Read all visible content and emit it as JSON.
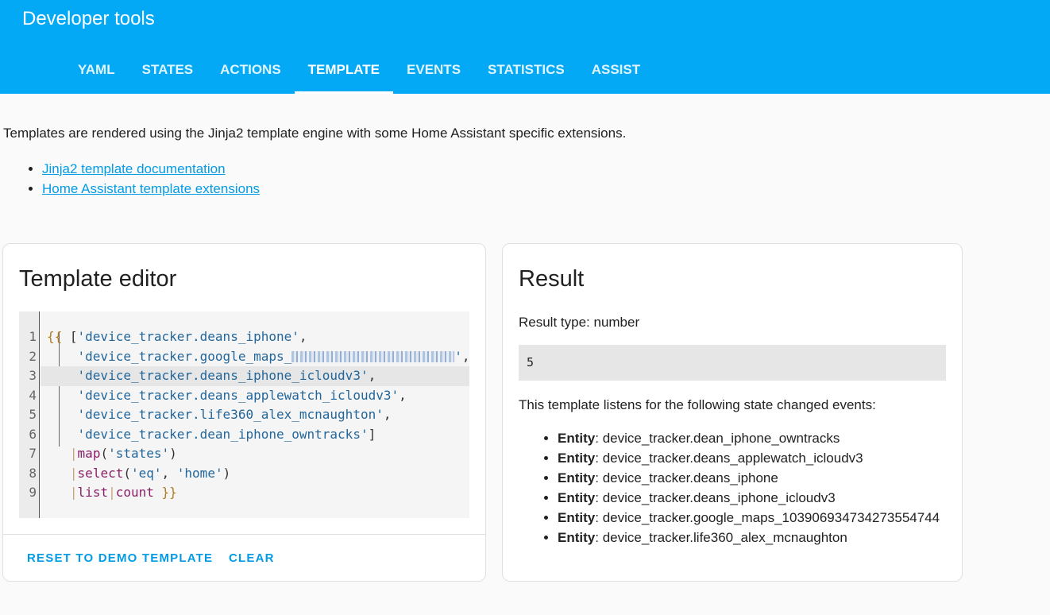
{
  "header": {
    "title": "Developer tools",
    "tabs": [
      {
        "label": "YAML"
      },
      {
        "label": "STATES"
      },
      {
        "label": "ACTIONS"
      },
      {
        "label": "TEMPLATE",
        "active": true
      },
      {
        "label": "EVENTS"
      },
      {
        "label": "STATISTICS"
      },
      {
        "label": "ASSIST"
      }
    ]
  },
  "intro": {
    "text": "Templates are rendered using the Jinja2 template engine with some Home Assistant specific extensions.",
    "links": [
      "Jinja2 template documentation",
      "Home Assistant template extensions"
    ]
  },
  "editor": {
    "title": "Template editor",
    "lines": [
      {
        "n": "1",
        "parts": [
          [
            "brace",
            "{{"
          ],
          [
            "pun",
            " ["
          ],
          [
            "str",
            "'device_tracker.deans_iphone'"
          ],
          [
            "pun",
            ","
          ]
        ]
      },
      {
        "n": "2",
        "parts": [
          [
            "pun",
            "    "
          ],
          [
            "str",
            "'device_tracker.google_maps_"
          ],
          [
            "blur",
            ""
          ],
          [
            "str",
            "'"
          ],
          [
            "pun",
            ","
          ]
        ]
      },
      {
        "n": "3",
        "parts": [
          [
            "pun",
            "    "
          ],
          [
            "str",
            "'device_tracker.deans_iphone_icloudv3'"
          ],
          [
            "pun",
            ","
          ]
        ]
      },
      {
        "n": "4",
        "parts": [
          [
            "pun",
            "    "
          ],
          [
            "str",
            "'device_tracker.deans_applewatch_icloudv3'"
          ],
          [
            "pun",
            ","
          ]
        ]
      },
      {
        "n": "5",
        "parts": [
          [
            "pun",
            "    "
          ],
          [
            "str",
            "'device_tracker.life360_alex_mcnaughton'"
          ],
          [
            "pun",
            ","
          ]
        ]
      },
      {
        "n": "6",
        "parts": [
          [
            "pun",
            "    "
          ],
          [
            "str",
            "'device_tracker.dean_iphone_owntracks'"
          ],
          [
            "pun",
            "]"
          ]
        ]
      },
      {
        "n": "7",
        "parts": [
          [
            "pun",
            "   "
          ],
          [
            "pipe",
            "|"
          ],
          [
            "fn",
            "map"
          ],
          [
            "pun",
            "("
          ],
          [
            "str",
            "'states'"
          ],
          [
            "pun",
            ")"
          ]
        ]
      },
      {
        "n": "8",
        "parts": [
          [
            "pun",
            "   "
          ],
          [
            "pipe",
            "|"
          ],
          [
            "fn",
            "select"
          ],
          [
            "pun",
            "("
          ],
          [
            "str",
            "'eq'"
          ],
          [
            "pun",
            ", "
          ],
          [
            "str",
            "'home'"
          ],
          [
            "pun",
            ")"
          ]
        ]
      },
      {
        "n": "9",
        "parts": [
          [
            "pun",
            "   "
          ],
          [
            "pipe",
            "|"
          ],
          [
            "fn",
            "list"
          ],
          [
            "pipe",
            "|"
          ],
          [
            "fn",
            "count"
          ],
          [
            "pun",
            " "
          ],
          [
            "brace",
            "}}"
          ]
        ]
      }
    ],
    "reset_label": "RESET TO DEMO TEMPLATE",
    "clear_label": "CLEAR"
  },
  "result": {
    "title": "Result",
    "type_text": "Result type: number",
    "value": "5",
    "listens_text": "This template listens for the following state changed events:",
    "entity_label": "Entity",
    "entities": [
      "device_tracker.dean_iphone_owntracks",
      "device_tracker.deans_applewatch_icloudv3",
      "device_tracker.deans_iphone",
      "device_tracker.deans_iphone_icloudv3",
      "device_tracker.google_maps_103906934734273554744",
      "device_tracker.life360_alex_mcnaughton"
    ]
  },
  "colors": {
    "accent": "#03a9f4",
    "link": "#039be5"
  }
}
